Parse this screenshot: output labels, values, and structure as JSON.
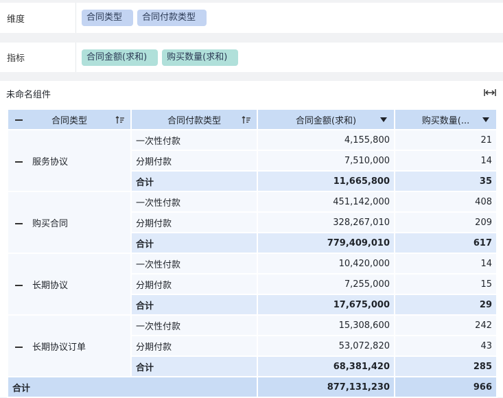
{
  "dimension_bar": {
    "label": "维度",
    "chips": [
      "合同类型",
      "合同付款类型"
    ]
  },
  "indicator_bar": {
    "label": "指标",
    "chips": [
      "合同金额(求和)",
      "购买数量(求和)"
    ]
  },
  "widget": {
    "title": "未命名组件",
    "table": {
      "headers": [
        "合同类型",
        "合同付款类型",
        "合同金额(求和)",
        "购买数量(..."
      ],
      "groups": [
        {
          "name": "服务协议",
          "rows": [
            {
              "type": "一次性付款",
              "amount": "4,155,800",
              "qty": "21"
            },
            {
              "type": "分期付款",
              "amount": "7,510,000",
              "qty": "14"
            },
            {
              "type": "合计",
              "amount": "11,665,800",
              "qty": "35"
            }
          ]
        },
        {
          "name": "购买合同",
          "rows": [
            {
              "type": "一次性付款",
              "amount": "451,142,000",
              "qty": "408"
            },
            {
              "type": "分期付款",
              "amount": "328,267,010",
              "qty": "209"
            },
            {
              "type": "合计",
              "amount": "779,409,010",
              "qty": "617"
            }
          ]
        },
        {
          "name": "长期协议",
          "rows": [
            {
              "type": "一次性付款",
              "amount": "10,420,000",
              "qty": "14"
            },
            {
              "type": "分期付款",
              "amount": "7,255,000",
              "qty": "15"
            },
            {
              "type": "合计",
              "amount": "17,675,000",
              "qty": "29"
            }
          ]
        },
        {
          "name": "长期协议订单",
          "rows": [
            {
              "type": "一次性付款",
              "amount": "15,308,600",
              "qty": "242"
            },
            {
              "type": "分期付款",
              "amount": "53,072,820",
              "qty": "43"
            },
            {
              "type": "合计",
              "amount": "68,381,420",
              "qty": "285"
            }
          ]
        }
      ],
      "grand_total": {
        "label": "合计",
        "amount": "877,131,230",
        "qty": "966"
      }
    }
  }
}
